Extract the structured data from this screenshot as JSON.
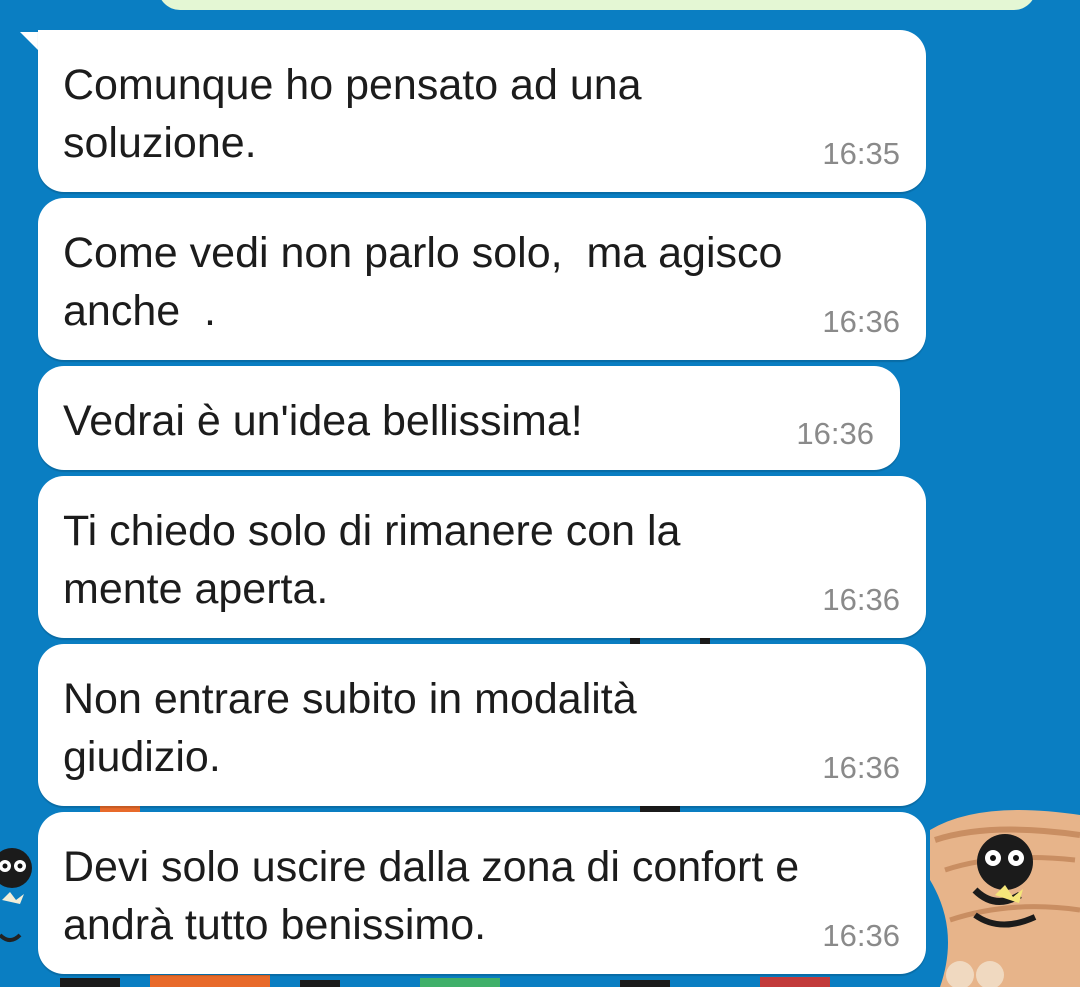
{
  "messages": [
    {
      "text": "Comunque ho pensato ad una\nsoluzione.",
      "time": "16:35"
    },
    {
      "text": "Come vedi non parlo solo,  ma agisco\nanche  .",
      "time": "16:36"
    },
    {
      "text": "Vedrai è un'idea bellissima!",
      "time": "16:36"
    },
    {
      "text": "Ti chiedo solo di rimanere con la\nmente aperta.",
      "time": "16:36"
    },
    {
      "text": "Non entrare subito in modalità\ngiudizio.",
      "time": "16:36"
    },
    {
      "text": "Devi solo uscire dalla zona di confort e\nandrà tutto benissimo.",
      "time": "16:36"
    }
  ],
  "colors": {
    "wallpaper": "#0a7ec2",
    "bubble_incoming": "#ffffff",
    "bubble_outgoing": "#e4f7d4",
    "text": "#1c1c1c",
    "time": "#8a8a8a"
  }
}
